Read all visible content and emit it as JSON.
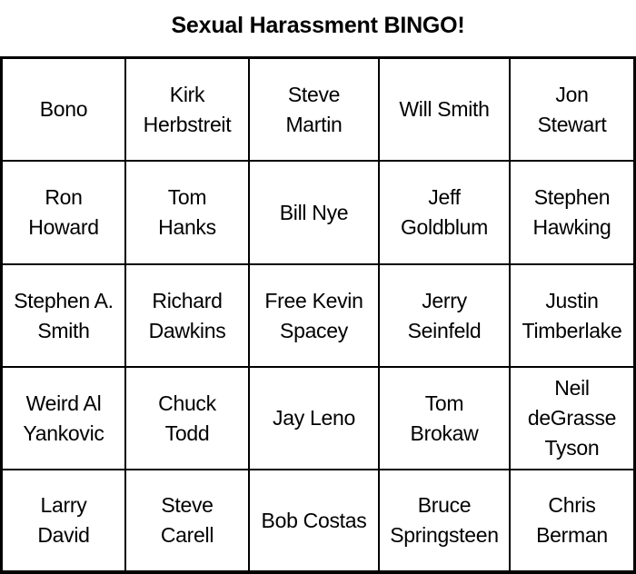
{
  "title": "Sexual Harassment BINGO!",
  "grid": {
    "rows": [
      [
        "Bono",
        "Kirk\nHerbstreit",
        "Steve\nMartin",
        "Will Smith",
        "Jon\nStewart"
      ],
      [
        "Ron\nHoward",
        "Tom\nHanks",
        "Bill Nye",
        "Jeff\nGoldblum",
        "Stephen\nHawking"
      ],
      [
        "Stephen A.\nSmith",
        "Richard\nDawkins",
        "Free Kevin\nSpacey",
        "Jerry\nSeinfeld",
        "Justin\nTimberlake"
      ],
      [
        "Weird Al\nYankovic",
        "Chuck\nTodd",
        "Jay Leno",
        "Tom\nBrokaw",
        "Neil\ndeGrasse\nTyson"
      ],
      [
        "Larry\nDavid",
        "Steve\nCarell",
        "Bob Costas",
        "Bruce\nSpringsteen",
        "Chris\nBerman"
      ]
    ]
  }
}
